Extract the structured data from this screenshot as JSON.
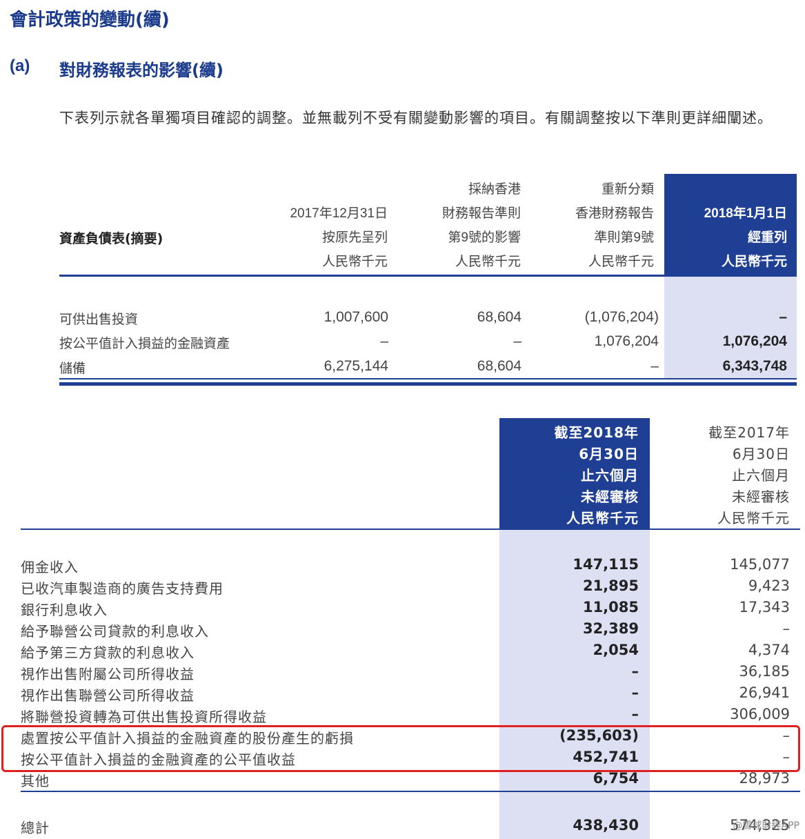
{
  "heading": {
    "title": "會計政策的變動(續)",
    "section_letter": "(a)",
    "section_title": "對財務報表的影響(續)"
  },
  "intro": "下表列示就各單獨項目確認的調整。並無載列不受有關變動影響的項目。有關調整按以下準則更詳細闡述。",
  "table1": {
    "row_header": "資產負債表(摘要)",
    "columns": [
      {
        "lines": [
          "2017年12月31日",
          "按原先呈列",
          "人民幣千元"
        ]
      },
      {
        "lines": [
          "採納香港",
          "財務報告準則",
          "第9號的影響",
          "人民幣千元"
        ]
      },
      {
        "lines": [
          "重新分類",
          "香港財務報告",
          "準則第9號",
          "人民幣千元"
        ]
      },
      {
        "lines": [
          "2018年1月1日",
          "經重列",
          "人民幣千元"
        ]
      }
    ],
    "rows": [
      {
        "label": "可供出售投資",
        "values": [
          "1,007,600",
          "68,604",
          "(1,076,204)",
          "–"
        ]
      },
      {
        "label": "按公平值計入損益的金融資產",
        "values": [
          "–",
          "–",
          "1,076,204",
          "1,076,204"
        ]
      },
      {
        "label": "儲備",
        "values": [
          "6,275,144",
          "68,604",
          "–",
          "6,343,748"
        ]
      }
    ]
  },
  "table2": {
    "columns": [
      {
        "lines": [
          "截至2018年",
          "6月30日",
          "止六個月",
          "未經審核",
          "人民幣千元"
        ]
      },
      {
        "lines": [
          "截至2017年",
          "6月30日",
          "止六個月",
          "未經審核",
          "人民幣千元"
        ]
      }
    ],
    "rows": [
      {
        "label": "佣金收入",
        "values": [
          "147,115",
          "145,077"
        ]
      },
      {
        "label": "已收汽車製造商的廣告支持費用",
        "values": [
          "21,895",
          "9,423"
        ]
      },
      {
        "label": "銀行利息收入",
        "values": [
          "11,085",
          "17,343"
        ]
      },
      {
        "label": "給予聯營公司貸款的利息收入",
        "values": [
          "32,389",
          "–"
        ]
      },
      {
        "label": "給予第三方貸款的利息收入",
        "values": [
          "2,054",
          "4,374"
        ]
      },
      {
        "label": "視作出售附屬公司所得收益",
        "values": [
          "–",
          "36,185"
        ]
      },
      {
        "label": "視作出售聯營公司所得收益",
        "values": [
          "–",
          "26,941"
        ]
      },
      {
        "label": "將聯營投資轉為可供出售投資所得收益",
        "values": [
          "–",
          "306,009"
        ]
      },
      {
        "label": "處置按公平值計入損益的金融資產的股份產生的虧損",
        "values": [
          "(235,603)",
          "–"
        ]
      },
      {
        "label": "按公平值計入損益的金融資產的公平值收益",
        "values": [
          "452,741",
          "–"
        ]
      },
      {
        "label": "其他",
        "values": [
          "6,754",
          "28,973"
        ]
      }
    ],
    "total": {
      "label": "總計",
      "values": [
        "438,430",
        "574,325"
      ]
    }
  },
  "watermark": "@雪球財經APP",
  "colors": {
    "navy": "#1e3f93",
    "band": "#dde0f3",
    "highlight_border": "#e02020"
  }
}
